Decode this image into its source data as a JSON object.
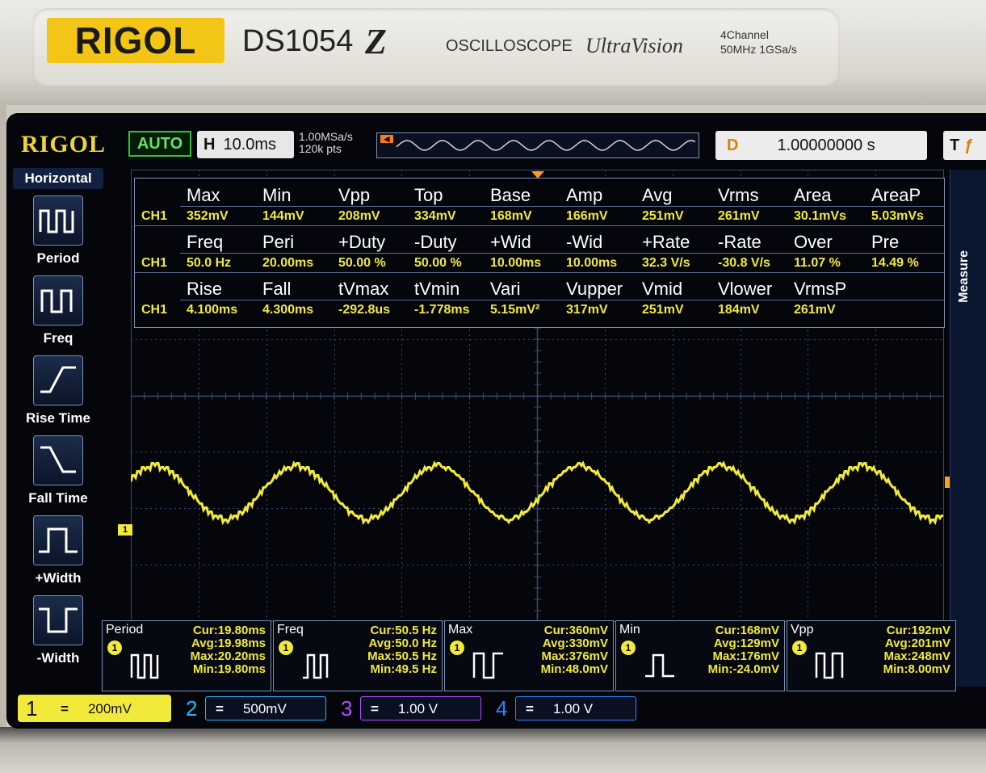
{
  "bezel": {
    "brand": "RIGOL",
    "model": "DS1054",
    "model_suffix": "Z",
    "type": "OSCILLOSCOPE",
    "series": "UltraVision",
    "channels_text": "4Channel",
    "specs": "50MHz  1GSa/s"
  },
  "topbar": {
    "logo": "RIGOL",
    "run_mode": "AUTO",
    "timebase_label": "H",
    "timebase_value": "10.0ms",
    "sample_rate": "1.00MSa/s",
    "memory_depth": "120k pts",
    "delay_label": "D",
    "delay_value": "1.00000000 s",
    "trigger_label": "T"
  },
  "sidemenu": {
    "title": "Horizontal",
    "items": [
      {
        "label": "Period",
        "icon": "period-icon"
      },
      {
        "label": "Freq",
        "icon": "freq-icon"
      },
      {
        "label": "Rise Time",
        "icon": "rise-time-icon"
      },
      {
        "label": "Fall Time",
        "icon": "fall-time-icon"
      },
      {
        "label": "+Width",
        "icon": "plus-width-icon"
      },
      {
        "label": "-Width",
        "icon": "minus-width-icon"
      }
    ]
  },
  "right_tab": {
    "label": "Measure"
  },
  "measurements": {
    "channel": "CH1",
    "rows": [
      {
        "headers": [
          "Max",
          "Min",
          "Vpp",
          "Top",
          "Base",
          "Amp",
          "Avg",
          "Vrms",
          "Area",
          "AreaP"
        ],
        "values": [
          "352mV",
          "144mV",
          "208mV",
          "334mV",
          "168mV",
          "166mV",
          "251mV",
          "261mV",
          "30.1mVs",
          "5.03mVs"
        ]
      },
      {
        "headers": [
          "Freq",
          "Peri",
          "+Duty",
          "-Duty",
          "+Wid",
          "-Wid",
          "+Rate",
          "-Rate",
          "Over",
          "Pre"
        ],
        "values": [
          "50.0 Hz",
          "20.00ms",
          "50.00 %",
          "50.00 %",
          "10.00ms",
          "10.00ms",
          "32.3 V/s",
          "-30.8 V/s",
          "11.07 %",
          "14.49 %"
        ]
      },
      {
        "headers": [
          "Rise",
          "Fall",
          "tVmax",
          "tVmin",
          "Vari",
          "Vupper",
          "Vmid",
          "Vlower",
          "VrmsP",
          ""
        ],
        "values": [
          "4.100ms",
          "4.300ms",
          "-292.8us",
          "-1.778ms",
          "5.15mV²",
          "317mV",
          "251mV",
          "184mV",
          "261mV",
          ""
        ]
      }
    ]
  },
  "stats": [
    {
      "name": "Period",
      "channel": "1",
      "cur": "Cur:19.80ms",
      "avg": "Avg:19.98ms",
      "max": "Max:20.20ms",
      "min": "Min:19.80ms"
    },
    {
      "name": "Freq",
      "channel": "1",
      "cur": "Cur:50.5 Hz",
      "avg": "Avg:50.0 Hz",
      "max": "Max:50.5 Hz",
      "min": "Min:49.5 Hz"
    },
    {
      "name": "Max",
      "channel": "1",
      "cur": "Cur:360mV",
      "avg": "Avg:330mV",
      "max": "Max:376mV",
      "min": "Min:48.0mV"
    },
    {
      "name": "Min",
      "channel": "1",
      "cur": "Cur:168mV",
      "avg": "Avg:129mV",
      "max": "Max:176mV",
      "min": "Min:-24.0mV"
    },
    {
      "name": "Vpp",
      "channel": "1",
      "cur": "Cur:192mV",
      "avg": "Avg:201mV",
      "max": "Max:248mV",
      "min": "Min:8.00mV"
    }
  ],
  "channels": [
    {
      "num": "1",
      "coupling": "=",
      "scale": "200mV",
      "color": "#f2ea3a"
    },
    {
      "num": "2",
      "coupling": "=",
      "scale": "500mV",
      "color": "#27b6ff"
    },
    {
      "num": "3",
      "coupling": "=",
      "scale": "1.00 V",
      "color": "#b44bff"
    },
    {
      "num": "4",
      "coupling": "=",
      "scale": "1.00 V",
      "color": "#2a86ff"
    }
  ],
  "markers": {
    "ch1": "1",
    "trigger": "T"
  },
  "waveform": {
    "color": "#f2ea3a",
    "cycles_visible": 6
  }
}
